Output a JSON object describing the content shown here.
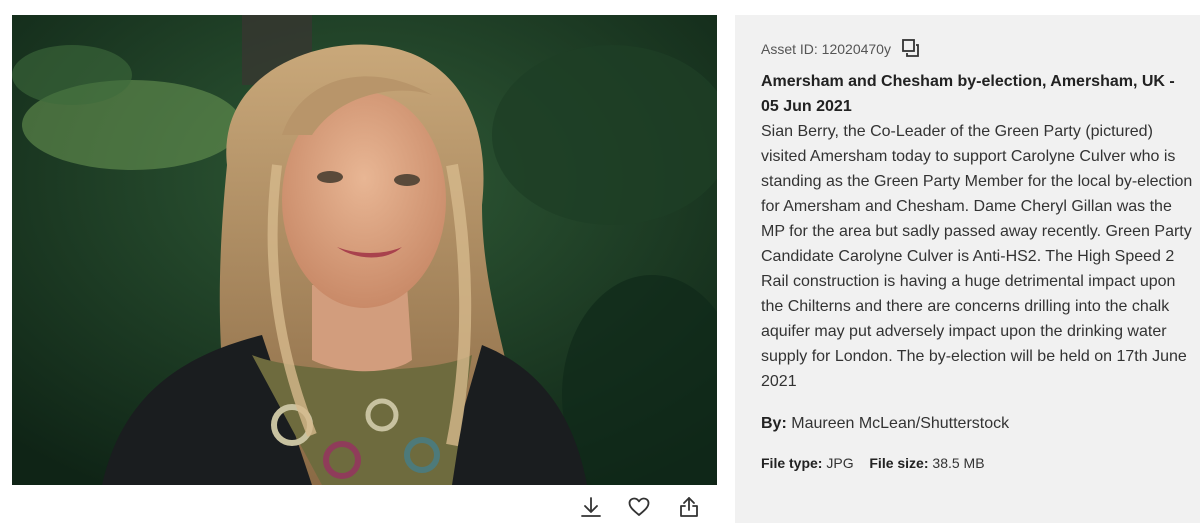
{
  "photo": {
    "alt": "Sian Berry smiling outdoors"
  },
  "actions": {
    "download_icon": "download-icon",
    "like_icon": "heart-icon",
    "share_icon": "share-icon"
  },
  "info": {
    "asset_label": "Asset ID: 12020470y",
    "copy_icon": "copy-icon",
    "title": "Amersham and Chesham by-election, Amersham, UK - 05 Jun 2021",
    "description": "Sian Berry, the Co-Leader of the Green Party (pictured) visited Amersham today to support Carolyne Culver who is standing as the Green Party Member for the local by-election for Amersham and Chesham. Dame Cheryl Gillan was the MP for the area but sadly passed away recently. Green Party Candidate Carolyne Culver is Anti-HS2. The High Speed 2 Rail construction is having a huge detrimental impact upon the Chilterns and there are concerns drilling into the chalk aquifer may put adversely impact upon the drinking water supply for London. The by-election will be held on 17th June 2021",
    "by_label": "By:",
    "by_value": "Maureen McLean/Shutterstock",
    "file_type_label": "File type:",
    "file_type_value": "JPG",
    "file_size_label": "File size:",
    "file_size_value": "38.5 MB"
  }
}
